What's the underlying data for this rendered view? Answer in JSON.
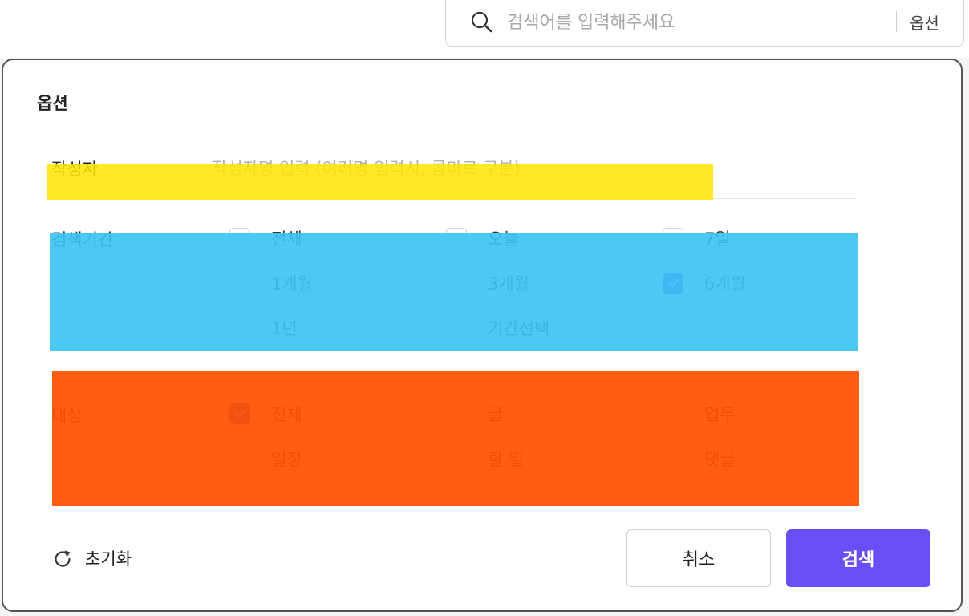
{
  "search": {
    "placeholder": "검색어를 입력해주세요",
    "value": "",
    "options_label": "옵션"
  },
  "dialog": {
    "title": "옵션",
    "author": {
      "label": "작성자",
      "placeholder": "작성자명 입력 (여러명 입력시, 콤마로 구분)",
      "value": ""
    },
    "period": {
      "label": "검색기간",
      "options": [
        {
          "label": "전체",
          "checked": false
        },
        {
          "label": "오늘",
          "checked": false
        },
        {
          "label": "7일",
          "checked": false
        },
        {
          "label": "1개월",
          "checked": false
        },
        {
          "label": "3개월",
          "checked": false
        },
        {
          "label": "6개월",
          "checked": true
        },
        {
          "label": "1년",
          "checked": false
        },
        {
          "label": "기간선택",
          "checked": false
        }
      ]
    },
    "target": {
      "label": "대상",
      "options": [
        {
          "label": "전체",
          "checked": true
        },
        {
          "label": "글",
          "checked": false
        },
        {
          "label": "업무",
          "checked": false
        },
        {
          "label": "일정",
          "checked": false
        },
        {
          "label": "할 일",
          "checked": false
        },
        {
          "label": "댓글",
          "checked": false
        }
      ]
    },
    "reset_label": "초기화",
    "cancel_label": "취소",
    "search_label": "검색"
  },
  "colors": {
    "accent": "#6b4ef6",
    "checkbox_checked": "#5a45f5",
    "highlight_yellow": "#ffe400",
    "highlight_blue": "#3ac4f3",
    "highlight_orange": "#ff5200"
  }
}
